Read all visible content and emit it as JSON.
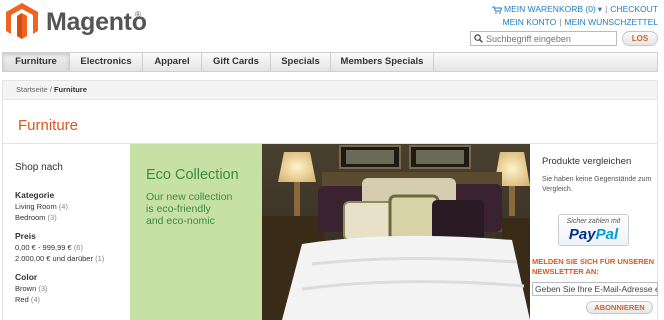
{
  "brand": {
    "name": "Magento",
    "reg": "®"
  },
  "header": {
    "cart": "MEIN WARENKORB (0)",
    "checkout": "CHECKOUT",
    "account": "MEIN KONTO",
    "wishlist": "MEIN WUNSCHZETTEL",
    "search_placeholder": "Suchbegriff eingeben",
    "search_button": "LOS"
  },
  "nav": [
    "Furniture",
    "Electronics",
    "Apparel",
    "Gift Cards",
    "Specials",
    "Members Specials"
  ],
  "breadcrumb": {
    "home": "Startseite",
    "sep": " / ",
    "current": "Furniture"
  },
  "page_title": "Furniture",
  "sidebar": {
    "heading": "Shop nach",
    "groups": [
      {
        "title": "Kategorie",
        "items": [
          {
            "label": "Living Room",
            "count": "(4)"
          },
          {
            "label": "Bedroom",
            "count": "(3)"
          }
        ]
      },
      {
        "title": "Preis",
        "items": [
          {
            "label": "0,00 € - 999,99 €",
            "count": "(6)"
          },
          {
            "label": "2.000,00 € und darüber",
            "count": "(1)"
          }
        ]
      },
      {
        "title": "Color",
        "items": [
          {
            "label": "Brown",
            "count": "(3)"
          },
          {
            "label": "Red",
            "count": "(4)"
          }
        ]
      }
    ]
  },
  "banner": {
    "title": "Eco Collection",
    "line1": "Our new collection",
    "line2": "is eco-friendly",
    "line3": "and eco-nomic"
  },
  "compare": {
    "heading": "Produkte vergleichen",
    "text": "Sie haben keine Gegenstände zum Vergleich."
  },
  "paypal": {
    "top": "Sicher zahlen mit",
    "pay": "Pay",
    "pal": "Pal"
  },
  "newsletter": {
    "heading": "MELDEN SIE SICH FÜR UNSEREN NEWSLETTER AN:",
    "placeholder": "Geben Sie Ihre E-Mail-Adresse ei",
    "button": "ABONNIEREN"
  },
  "colors": {
    "accent": "#e0561e",
    "link": "#1e7ec8",
    "banner_bg": "#c7e0a4",
    "banner_text": "#3f8a3f"
  }
}
